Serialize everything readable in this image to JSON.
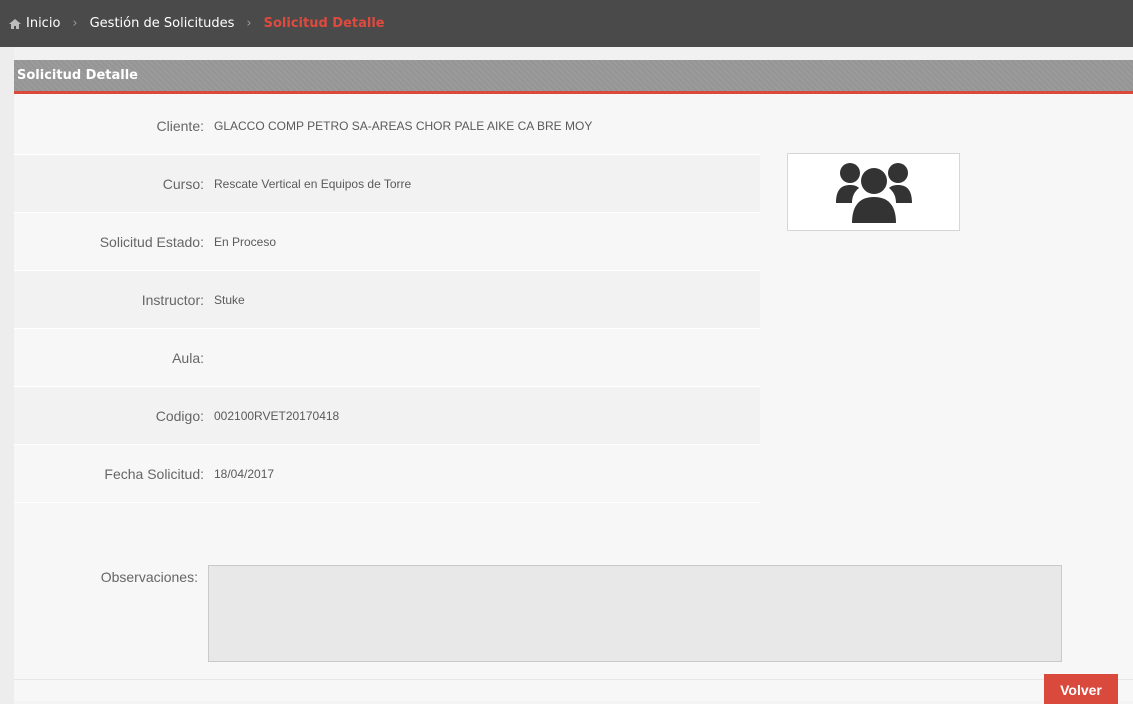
{
  "breadcrumb": {
    "home_label": "Inicio",
    "section_label": "Gestión de Solicitudes",
    "current_label": "Solicitud Detalle",
    "separator": "›"
  },
  "panel": {
    "title": "Solicitud Detalle"
  },
  "fields": [
    {
      "label": "Cliente:",
      "value": "GLACCO COMP PETRO SA-AREAS CHOR PALE AIKE CA BRE MOY"
    },
    {
      "label": "Curso:",
      "value": "Rescate Vertical en Equipos de Torre"
    },
    {
      "label": "Solicitud Estado:",
      "value": "En Proceso"
    },
    {
      "label": "Instructor:",
      "value": "Stuke"
    },
    {
      "label": "Aula:",
      "value": ""
    },
    {
      "label": "Codigo:",
      "value": "002100RVET20170418"
    },
    {
      "label": "Fecha Solicitud:",
      "value": "18/04/2017"
    }
  ],
  "observaciones": {
    "label": "Observaciones:",
    "value": ""
  },
  "actions": {
    "back_label": "Volver"
  },
  "icons": {
    "home": "home-icon",
    "group": "users-group-icon"
  },
  "colors": {
    "accent": "#d94a3d",
    "topbar": "#4b4a4a"
  }
}
